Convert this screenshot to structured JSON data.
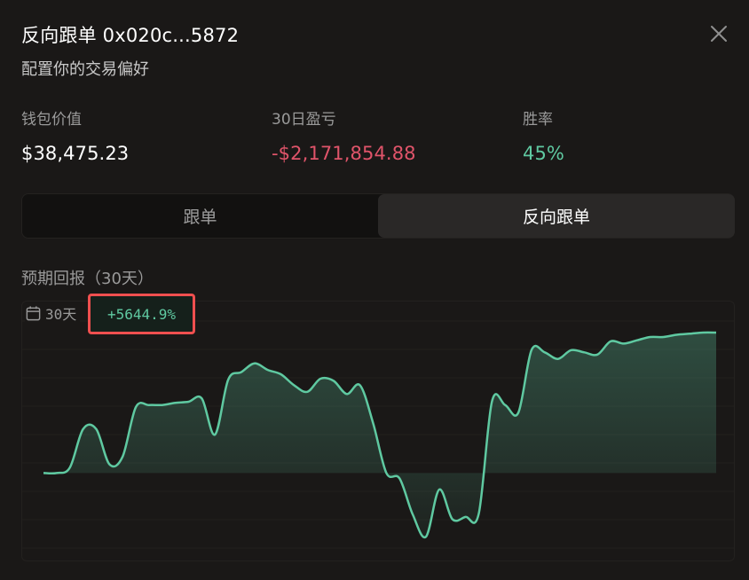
{
  "header": {
    "title": "反向跟单 0x020c...5872",
    "subtitle": "配置你的交易偏好",
    "close_icon": "close-icon"
  },
  "stats": {
    "wallet_label": "钱包价值",
    "wallet_value": "$38,475.23",
    "pnl_label": "30日盈亏",
    "pnl_value": "-$2,171,854.88",
    "winrate_label": "胜率",
    "winrate_value": "45%"
  },
  "mode_toggle": {
    "follow_label": "跟单",
    "reverse_label": "反向跟单",
    "selected": "reverse"
  },
  "expected_return": {
    "section_title": "预期回报（30天）",
    "period_label": "30天",
    "calendar_icon": "calendar-icon",
    "return_value": "+5644.9%"
  },
  "colors": {
    "positive": "#5fc9a1",
    "negative": "#e0546a",
    "highlight_border": "#ef4f4f",
    "background": "#1a1817"
  },
  "chart_data": {
    "type": "area",
    "title": "",
    "xlabel": "",
    "ylabel": "",
    "grid": true,
    "baseline": 0,
    "ylim": [
      -70,
      145
    ],
    "series": [
      {
        "values": [
          0,
          0,
          5,
          40,
          40,
          8,
          15,
          60,
          62,
          62,
          64,
          65,
          68,
          35,
          85,
          92,
          100,
          94,
          90,
          80,
          74,
          86,
          84,
          72,
          80,
          45,
          0,
          -5,
          -38,
          -58,
          -15,
          -42,
          -40,
          -37,
          65,
          62,
          55,
          112,
          110,
          104,
          112,
          110,
          108,
          120,
          118,
          121,
          124,
          124,
          126,
          127,
          128,
          128
        ]
      }
    ]
  }
}
